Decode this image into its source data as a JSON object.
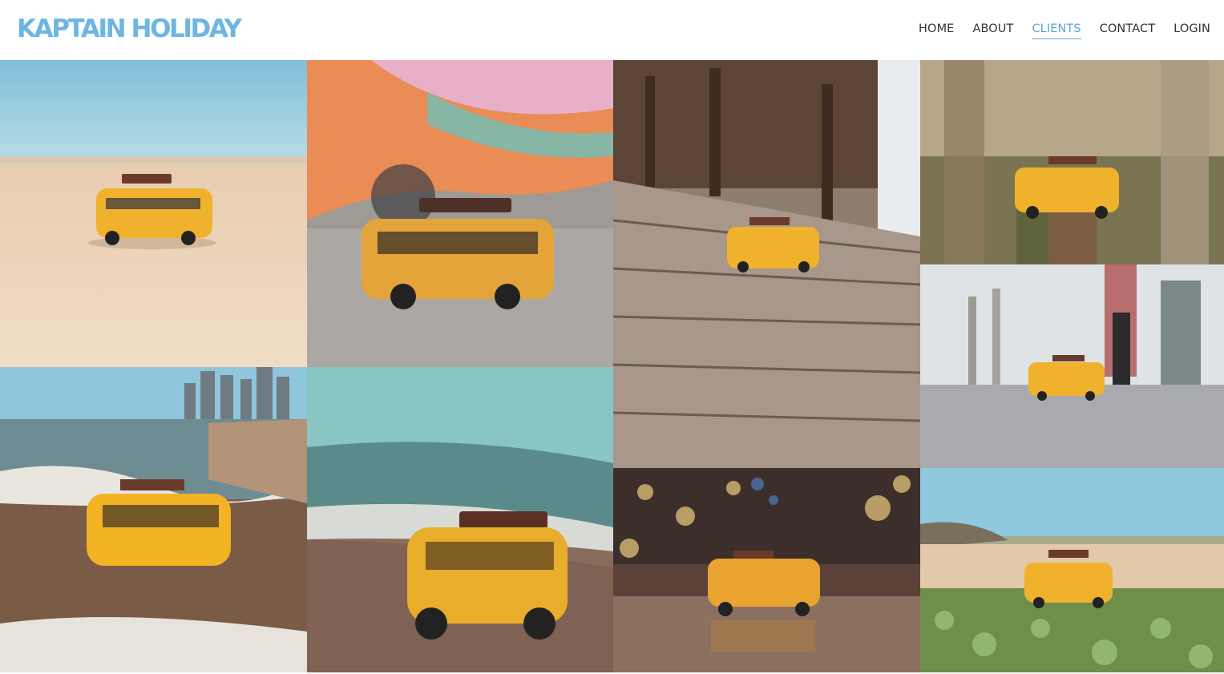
{
  "brand": {
    "name": "KAPTAIN HOLIDAY",
    "color": "#6db6e3"
  },
  "nav": {
    "items": [
      {
        "label": "HOME"
      },
      {
        "label": "ABOUT"
      },
      {
        "label": "CLIENTS",
        "active": true
      },
      {
        "label": "CONTACT"
      },
      {
        "label": "LOGIN"
      }
    ],
    "active_color": "#5aa5d6"
  },
  "gallery": {
    "photos": [
      {
        "subject": "toy-bus-on-beach-sand"
      },
      {
        "subject": "toy-bus-in-front-of-painted-van"
      },
      {
        "subject": "toy-bus-on-wooden-deck"
      },
      {
        "subject": "toy-bus-on-wooden-post"
      },
      {
        "subject": "toy-bus-in-sea-waves"
      },
      {
        "subject": "toy-bus-on-shore"
      },
      {
        "subject": "toy-bus-on-pavement"
      },
      {
        "subject": "toy-bus-on-reflective-floor"
      },
      {
        "subject": "toy-bus-on-grass-by-beach"
      }
    ]
  }
}
